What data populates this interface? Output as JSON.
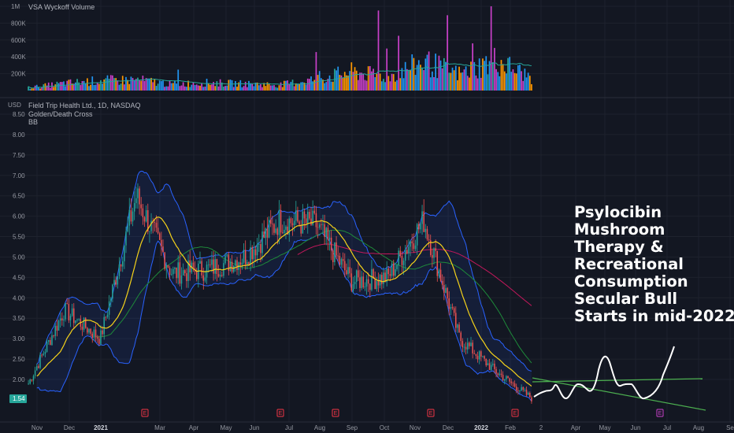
{
  "volume_panel": {
    "title": "VSA Wyckoff Volume",
    "y_ticks": [
      "1M",
      "800K",
      "600K",
      "400K",
      "200K"
    ]
  },
  "price_panel": {
    "currency": "USD",
    "symbol_line": "Field Trip Health Ltd., 1D, NASDAQ",
    "indicator_1": "Golden/Death Cross",
    "indicator_2": "BB",
    "y_ticks": [
      "8.50",
      "8.00",
      "7.50",
      "7.00",
      "6.50",
      "6.00",
      "5.50",
      "5.00",
      "4.50",
      "4.00",
      "3.50",
      "3.00",
      "2.50",
      "2.00"
    ],
    "last_price": "1.54",
    "earnings_marker": "E"
  },
  "x_axis": {
    "labels": [
      "Nov",
      "Dec",
      "2021",
      "Mar",
      "Apr",
      "May",
      "Jun",
      "Jul",
      "Aug",
      "Sep",
      "Oct",
      "Nov",
      "Dec",
      "2022",
      "Feb",
      "2",
      "Apr",
      "May",
      "Jun",
      "Jul",
      "Aug",
      "Se"
    ]
  },
  "annotation": {
    "lines": [
      "Psylocibin",
      "Mushroom",
      "Therapy &",
      "Recreational",
      "Consumption",
      "Secular Bull",
      "Starts in mid-2022"
    ]
  },
  "colors": {
    "background": "#131722",
    "bull": "#26a69a",
    "bear": "#ef5350",
    "yellow_ma": "#f5d21a",
    "green_ma": "#1e8a3a",
    "red_ma": "#c2185b",
    "bb_band": "#2962ff",
    "volume_magenta": "#c940c9",
    "volume_orange": "#ff9800",
    "volume_blue": "#2196f3",
    "projection": "#ffffff",
    "trendline": "#4caf50"
  },
  "chart_data": [
    {
      "type": "line",
      "title": "Field Trip Health Ltd., 1D, NASDAQ",
      "ylabel": "USD",
      "ylim": [
        1.3,
        8.7
      ],
      "x": [
        "Nov",
        "Dec",
        "2021",
        "Mar",
        "Apr",
        "May",
        "Jun",
        "Jul",
        "Aug",
        "Sep",
        "Oct",
        "Nov",
        "Dec",
        "2022",
        "Feb"
      ],
      "series": [
        {
          "name": "Close",
          "values": [
            1.9,
            3.7,
            3.0,
            6.5,
            4.6,
            4.7,
            5.0,
            5.9,
            5.8,
            4.4,
            4.5,
            5.9,
            3.0,
            2.2,
            1.54
          ]
        }
      ]
    },
    {
      "type": "bar",
      "title": "VSA Wyckoff Volume",
      "ylim": [
        0,
        1000000
      ],
      "categories": [
        "Nov",
        "Dec",
        "2021",
        "Mar",
        "Apr",
        "May",
        "Jun",
        "Jul",
        "Aug",
        "Sep",
        "Oct",
        "Nov",
        "Dec",
        "2022",
        "Feb"
      ],
      "values": [
        40000,
        100000,
        140000,
        150000,
        90000,
        110000,
        95000,
        80000,
        160000,
        260000,
        190000,
        400000,
        230000,
        420000,
        180000
      ]
    }
  ]
}
